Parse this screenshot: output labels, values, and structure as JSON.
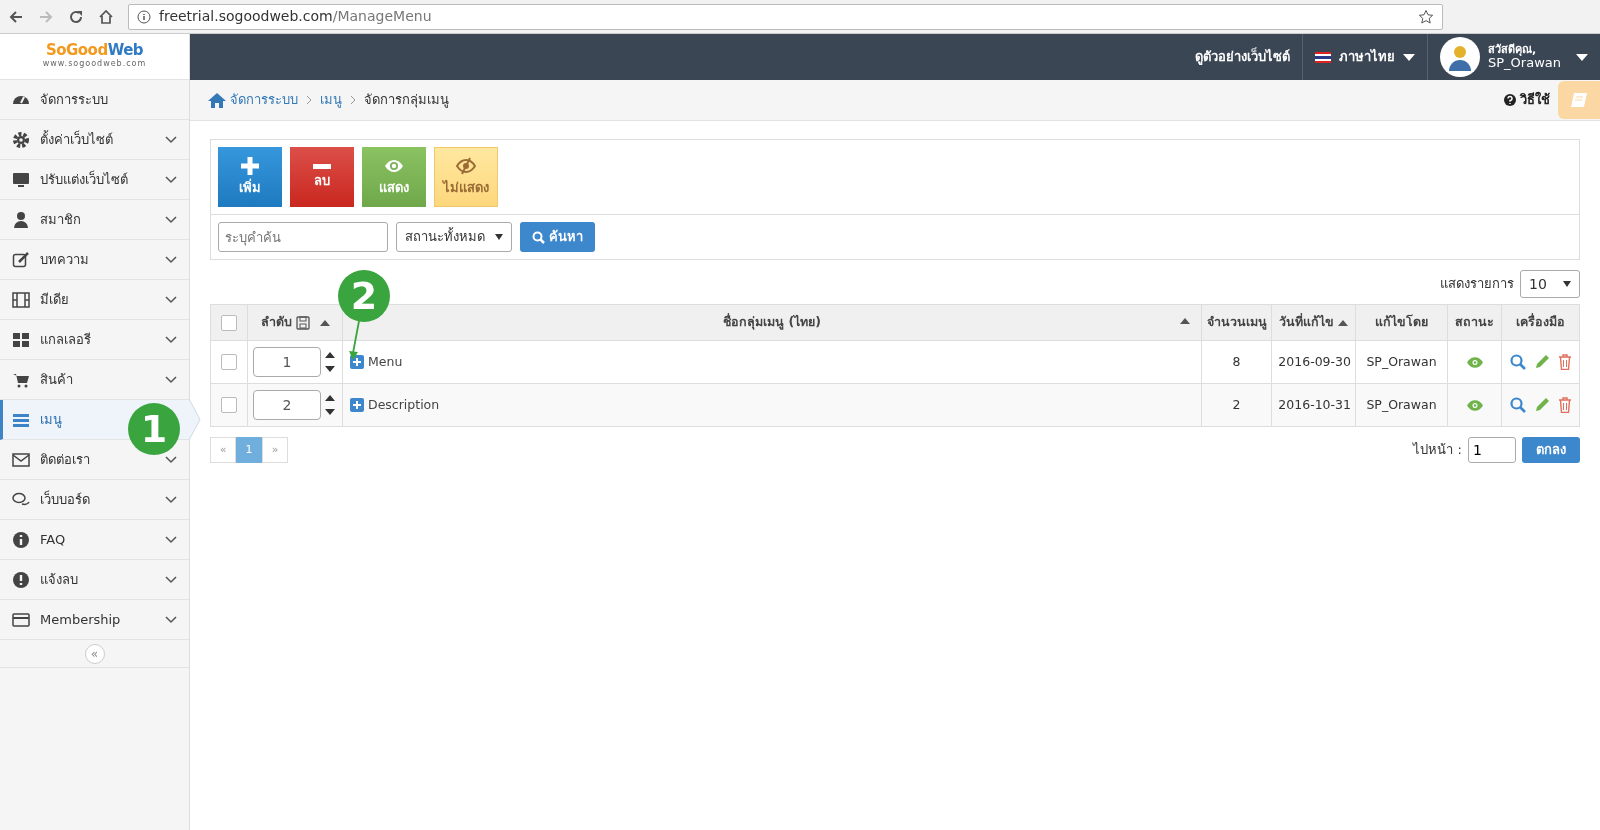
{
  "browser": {
    "url_host": "freetrial.sogoodweb.com",
    "url_path": "/ManageMenu"
  },
  "logo": {
    "brand_1": "SoGood",
    "brand_2": "Web",
    "tagline": "www.sogoodweb.com"
  },
  "header": {
    "preview_link": "ดูตัวอย่างเว็บไซต์",
    "language": "ภาษาไทย",
    "greeting": "สวัสดีคุณ,",
    "user_name": "SP_Orawan"
  },
  "breadcrumb": [
    {
      "label": "จัดการระบบ",
      "kind": "home"
    },
    {
      "label": "เมนู",
      "kind": "link"
    },
    {
      "label": "จัดการกลุ่มเมนู",
      "kind": "current"
    }
  ],
  "help": "วิธีใช้",
  "sidebar": {
    "items": [
      {
        "label": "จัดการระบบ",
        "selected": false,
        "expandable": false
      },
      {
        "label": "ตั้งค่าเว็บไซต์",
        "selected": false,
        "expandable": true
      },
      {
        "label": "ปรับแต่งเว็บไซต์",
        "selected": false,
        "expandable": true
      },
      {
        "label": "สมาชิก",
        "selected": false,
        "expandable": true
      },
      {
        "label": "บทความ",
        "selected": false,
        "expandable": true
      },
      {
        "label": "มีเดีย",
        "selected": false,
        "expandable": true
      },
      {
        "label": "แกลเลอรี",
        "selected": false,
        "expandable": true
      },
      {
        "label": "สินค้า",
        "selected": false,
        "expandable": true
      },
      {
        "label": "เมนู",
        "selected": true,
        "expandable": false
      },
      {
        "label": "ติดต่อเรา",
        "selected": false,
        "expandable": true
      },
      {
        "label": "เว็บบอร์ด",
        "selected": false,
        "expandable": true
      },
      {
        "label": "FAQ",
        "selected": false,
        "expandable": true
      },
      {
        "label": "แจ้งลบ",
        "selected": false,
        "expandable": true
      },
      {
        "label": "Membership",
        "selected": false,
        "expandable": true
      }
    ],
    "collapse": "«"
  },
  "toolbar": [
    {
      "label": "เพิ่ม",
      "kind": "add"
    },
    {
      "label": "ลบ",
      "kind": "delete"
    },
    {
      "label": "แสดง",
      "kind": "show"
    },
    {
      "label": "ไม่แสดง",
      "kind": "hide"
    }
  ],
  "search": {
    "placeholder": "ระบุคำค้น",
    "status": "สถานะทั้งหมด",
    "button": "ค้นหา"
  },
  "page_size": {
    "label": "แสดงรายการ",
    "value": "10"
  },
  "table": {
    "select_all": {
      "checked": false
    },
    "columns": [
      {
        "label": "ลำดับ",
        "sorted": true
      },
      {
        "label": "ชื่อกลุ่มเมนู (ไทย)",
        "sorted": true
      },
      {
        "label": "จำนวนเมนู",
        "sorted": false
      },
      {
        "label": "วันที่แก้ไข",
        "sorted": true
      },
      {
        "label": "แก้ไขโดย",
        "sorted": false
      },
      {
        "label": "สถานะ",
        "sorted": false
      },
      {
        "label": "เครื่องมือ",
        "sorted": false
      }
    ],
    "rows": [
      {
        "checked": false,
        "order": "1",
        "name": "Menu",
        "count": "8",
        "modified": "2016-09-30",
        "modified_by": "SP_Orawan",
        "visible": true
      },
      {
        "checked": false,
        "order": "2",
        "name": "Description",
        "count": "2",
        "modified": "2016-10-31",
        "modified_by": "SP_Orawan",
        "visible": true
      }
    ]
  },
  "pagination": {
    "prev": "«",
    "pages": [
      {
        "label": "1",
        "selected": true
      }
    ],
    "next": "»"
  },
  "goto": {
    "label": "ไปหน้า :",
    "value": "1",
    "button": "ตกลง"
  },
  "annotations": [
    {
      "label": "1"
    },
    {
      "label": "2"
    }
  ]
}
